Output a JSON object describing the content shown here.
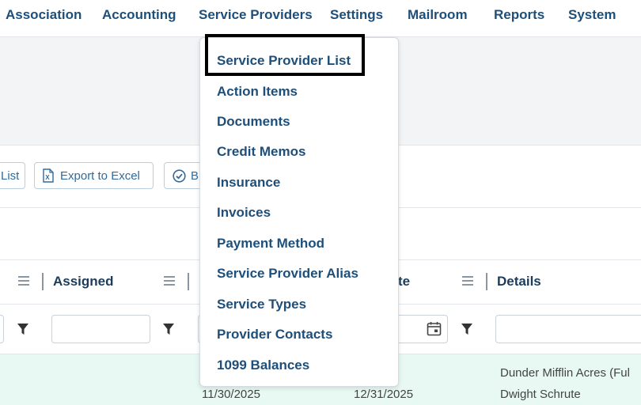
{
  "nav": {
    "items": [
      "Association",
      "Accounting",
      "Service Providers",
      "Settings",
      "Mailroom",
      "Reports",
      "System"
    ]
  },
  "toolbar": {
    "list_button_fragment": "List",
    "export_button": "Export to Excel",
    "third_button_fragment": "B"
  },
  "grid": {
    "columns": {
      "assigned": "Assigned",
      "date_fragment": "te",
      "details": "Details"
    },
    "row": {
      "date1": "11/30/2025",
      "date2": "12/31/2025",
      "details_line1": "Dunder Mifflin Acres (Ful",
      "details_line2": "Dwight Schrute"
    }
  },
  "dropdown": {
    "items": [
      "Service Provider List",
      "Action Items",
      "Documents",
      "Credit Memos",
      "Insurance",
      "Invoices",
      "Payment Method",
      "Service Provider Alias",
      "Service Types",
      "Provider Contacts",
      "1099 Balances"
    ],
    "highlighted_index": 0
  },
  "colors": {
    "nav_text": "#1d4f7a",
    "row_highlight": "#e8f8f2",
    "button_border": "#b9cfe0"
  }
}
